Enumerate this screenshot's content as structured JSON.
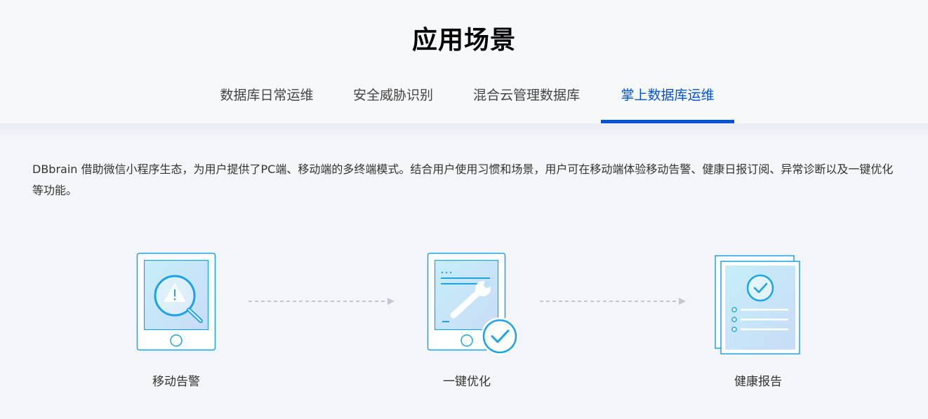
{
  "section": {
    "title": "应用场景"
  },
  "tabs": [
    {
      "label": "数据库日常运维",
      "active": false
    },
    {
      "label": "安全威胁识别",
      "active": false
    },
    {
      "label": "混合云管理数据库",
      "active": false
    },
    {
      "label": "掌上数据库运维",
      "active": true
    }
  ],
  "description": "DBbrain 借助微信小程序生态，为用户提供了PC端、移动端的多终端模式。结合用户使用习惯和场景，用户可在移动端体验移动告警、健康日报订阅、异常诊断以及一键优化等功能。",
  "steps": [
    {
      "label": "移动告警",
      "icon": "tablet-alert-magnifier-icon"
    },
    {
      "label": "一键优化",
      "icon": "tablet-wrench-check-icon"
    },
    {
      "label": "健康报告",
      "icon": "report-check-icon"
    }
  ],
  "colors": {
    "accent": "#0052d9",
    "icon_stroke": "#1aa3e8",
    "background": "#f3f5f9"
  }
}
